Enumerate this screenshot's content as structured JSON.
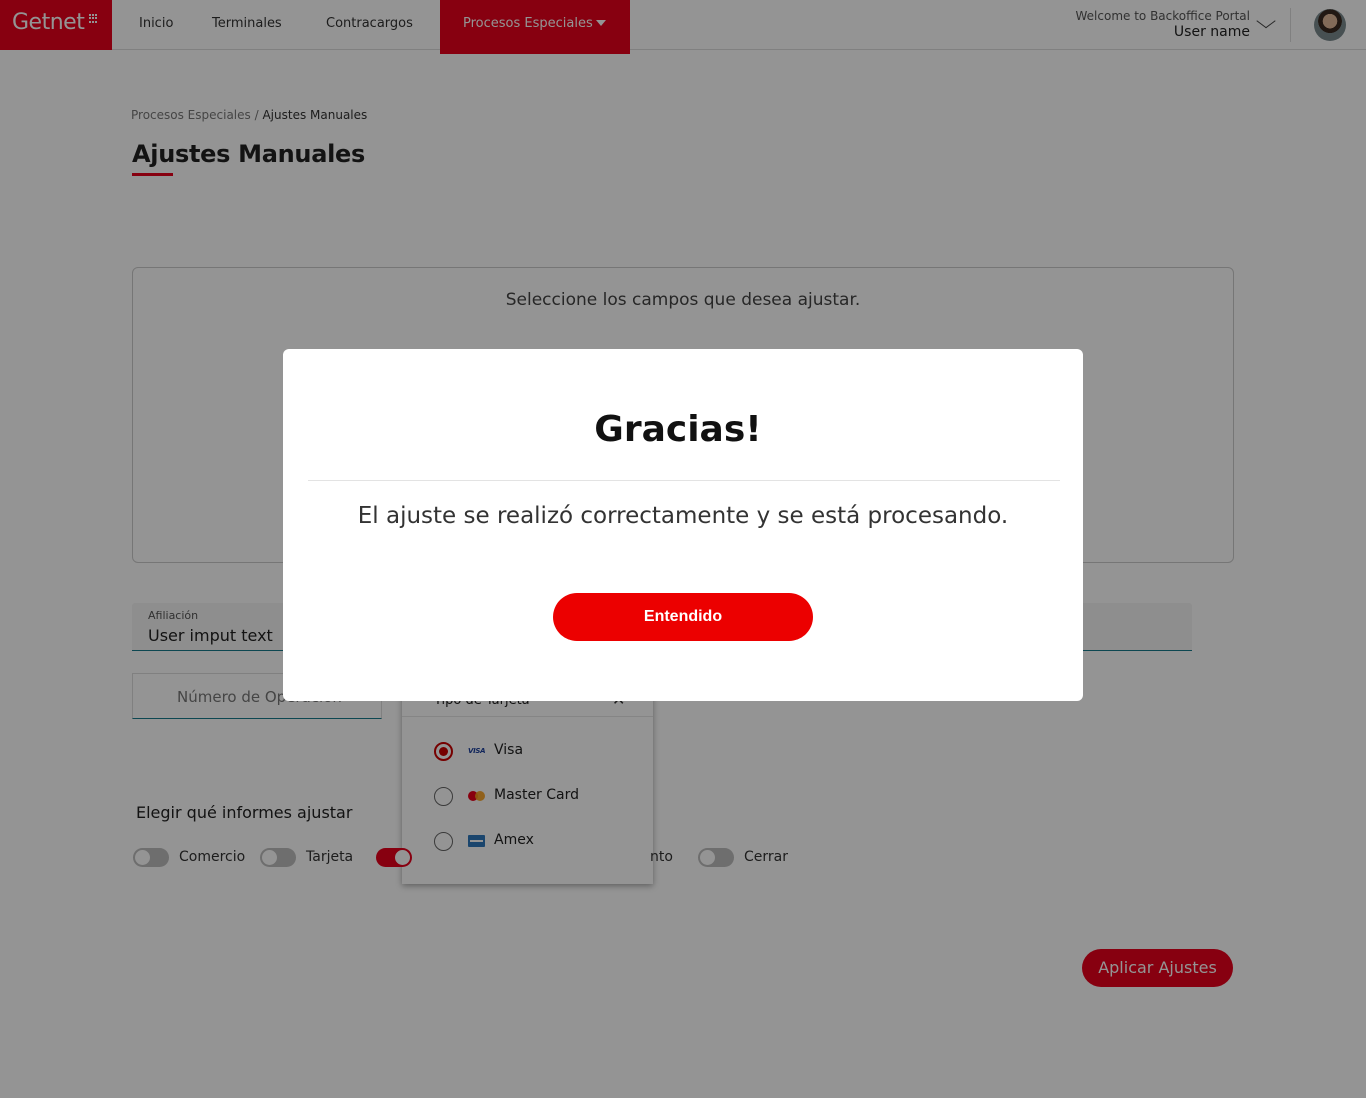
{
  "brand": {
    "logo_text": "Getnet",
    "accent": "#e8001c"
  },
  "nav": {
    "items": [
      "Inicio",
      "Terminales",
      "Contracargos"
    ],
    "active": "Procesos Especiales",
    "welcome": "Welcome to Backoffice Portal",
    "user_name": "User name"
  },
  "breadcrumb": {
    "parent": "Procesos Especiales",
    "separator": "/",
    "current": "Ajustes Manuales"
  },
  "page": {
    "title": "Ajustes Manuales",
    "panel_text": "Seleccione los campos que desea ajustar."
  },
  "form": {
    "afiliacion_label": "Afiliación",
    "afiliacion_value": "User imput text",
    "operacion_text": "Número de Operación"
  },
  "dropdown": {
    "header": "Tipo de Tarjeta",
    "close_glyph": "✕",
    "options": [
      {
        "label": "Visa",
        "icon": "visa-icon",
        "selected": true,
        "icon_text": "VISA"
      },
      {
        "label": "Master Card",
        "icon": "mastercard-icon",
        "selected": false
      },
      {
        "label": "Amex",
        "icon": "amex-icon",
        "selected": false
      }
    ]
  },
  "reports": {
    "title": "Elegir qué informes ajustar",
    "toggles": [
      {
        "label": "Comercio",
        "on": false
      },
      {
        "label": "Tarjeta",
        "on": false
      },
      {
        "label": "",
        "on": true
      },
      {
        "label": "nto",
        "on": false
      },
      {
        "label": "Cerrar",
        "on": false
      }
    ]
  },
  "actions": {
    "apply_label": "Aplicar Ajustes"
  },
  "modal": {
    "title": "Gracias!",
    "message": "El ajuste se realizó correctamente y se está procesando.",
    "button_label": "Entendido"
  }
}
